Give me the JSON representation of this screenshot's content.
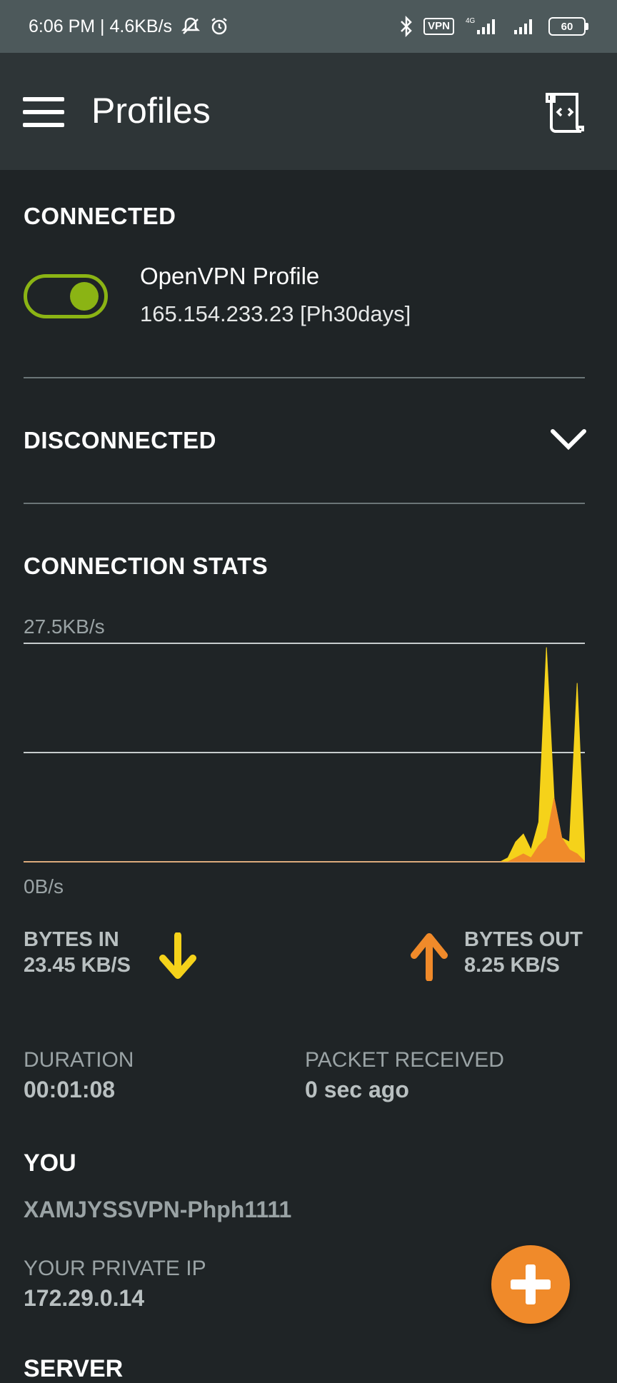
{
  "statusbar": {
    "time_speed": "6:06 PM | 4.6KB/s",
    "vpn_badge": "VPN",
    "network": "4G",
    "battery": "60"
  },
  "appbar": {
    "title": "Profiles"
  },
  "connected": {
    "title": "CONNECTED",
    "profile_name": "OpenVPN Profile",
    "profile_ip": "165.154.233.23 [Ph30days]",
    "toggle_on": true
  },
  "disconnected": {
    "title": "DISCONNECTED"
  },
  "stats": {
    "title": "CONNECTION STATS",
    "max_label": "27.5KB/s",
    "min_label": "0B/s",
    "bytes_in_label": "BYTES IN",
    "bytes_in_value": "23.45 KB/S",
    "bytes_out_label": "BYTES OUT",
    "bytes_out_value": "8.25 KB/S",
    "duration_label": "DURATION",
    "duration_value": "00:01:08",
    "packet_label": "PACKET RECEIVED",
    "packet_value": "0 sec ago"
  },
  "you": {
    "title": "YOU",
    "name": "XAMJYSSVPN-Phph1111",
    "private_ip_label": "YOUR PRIVATE IP",
    "private_ip_value": "172.29.0.14"
  },
  "server": {
    "title": "SERVER"
  },
  "colors": {
    "accent_green": "#8bb414",
    "bytes_in": "#f5d21a",
    "bytes_out": "#f08a2a",
    "fab": "#f08a2a"
  },
  "chart_data": {
    "type": "area",
    "x": [
      0,
      1,
      2,
      3,
      4,
      5,
      6,
      7,
      8,
      9,
      10,
      11,
      12,
      13,
      14,
      15,
      16,
      17,
      18,
      19,
      20,
      21,
      22,
      23,
      24,
      25,
      26,
      27,
      28,
      29,
      30,
      31,
      32,
      33,
      34,
      35,
      36,
      37,
      38,
      39,
      40,
      41,
      42,
      43,
      44,
      45,
      46,
      47,
      48,
      49,
      50,
      51,
      52,
      53,
      54,
      55,
      56,
      57,
      58,
      59,
      60,
      61,
      62,
      63,
      64,
      65,
      66,
      67,
      68,
      69
    ],
    "ylim": [
      0,
      27.5
    ],
    "series": [
      {
        "name": "BYTES IN",
        "values": [
          0,
          0,
          0,
          0,
          0,
          0,
          0,
          0,
          0,
          0,
          0,
          0,
          0,
          0,
          0,
          0,
          0,
          0,
          0,
          0,
          0,
          0,
          0,
          0,
          0,
          0,
          0,
          0,
          0,
          0,
          0,
          0,
          0,
          0,
          0,
          0,
          0,
          0,
          0,
          0,
          0,
          0,
          0,
          0,
          0,
          0,
          0,
          0,
          0,
          0,
          0,
          0,
          0,
          0,
          0,
          0,
          0,
          0,
          0,
          0,
          0,
          0,
          0,
          0.5,
          2.5,
          3.5,
          1.5,
          5,
          27,
          8,
          3,
          2.5,
          22.5,
          0
        ]
      },
      {
        "name": "BYTES OUT",
        "values": [
          0,
          0,
          0,
          0,
          0,
          0,
          0,
          0,
          0,
          0,
          0,
          0,
          0,
          0,
          0,
          0,
          0,
          0,
          0,
          0,
          0,
          0,
          0,
          0,
          0,
          0,
          0,
          0,
          0,
          0,
          0,
          0,
          0,
          0,
          0,
          0,
          0,
          0,
          0,
          0,
          0,
          0,
          0,
          0,
          0,
          0,
          0,
          0,
          0,
          0,
          0,
          0,
          0,
          0,
          0,
          0,
          0,
          0,
          0,
          0,
          0,
          0,
          0,
          0,
          0.5,
          1,
          0.5,
          2,
          3,
          8,
          3,
          1.5,
          1,
          0
        ]
      }
    ],
    "xlabel": "",
    "ylabel": "",
    "grid": true
  }
}
